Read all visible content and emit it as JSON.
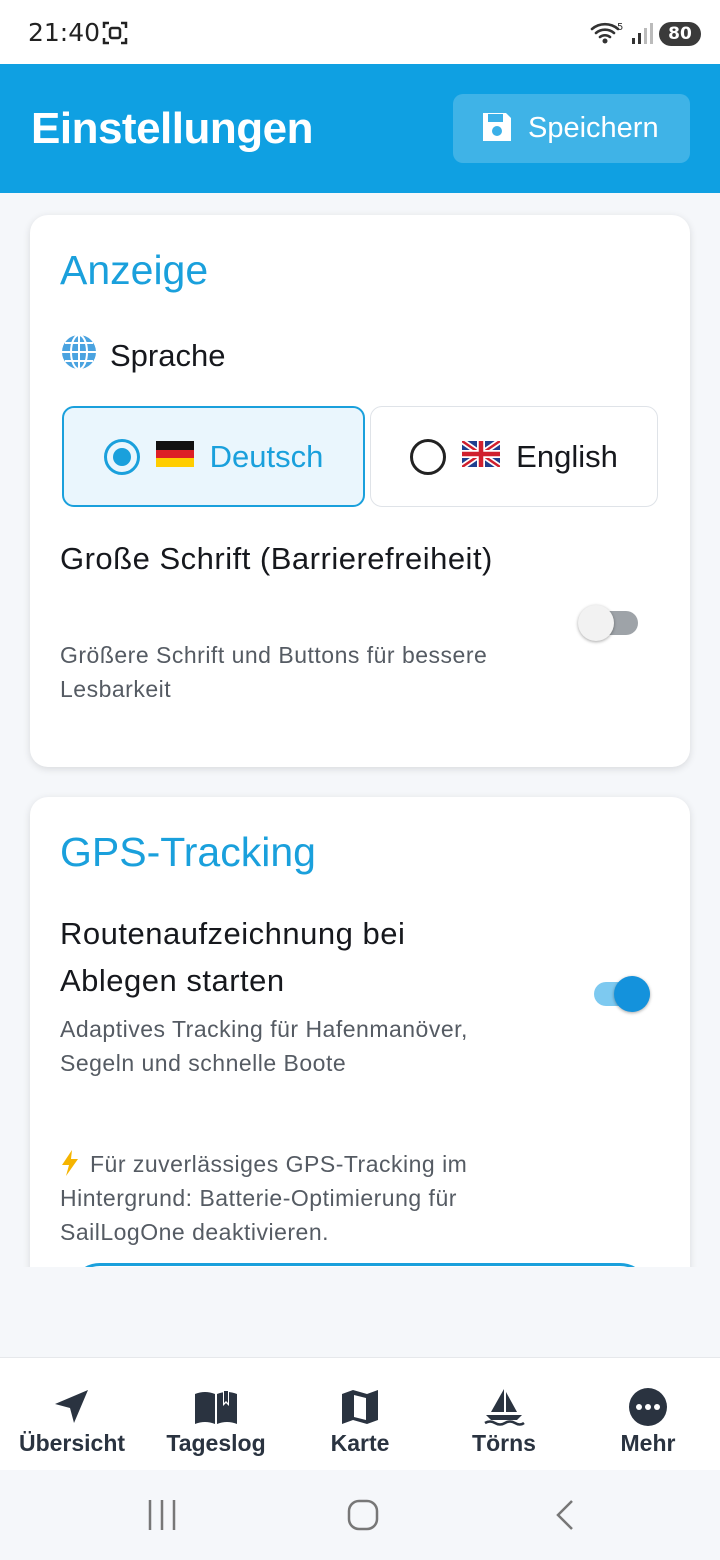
{
  "status_bar": {
    "time": "21:40",
    "battery": "80"
  },
  "header": {
    "title": "Einstellungen",
    "save_label": "Speichern"
  },
  "display_card": {
    "title": "Anzeige",
    "language_label": "Sprache",
    "languages": [
      {
        "label": "Deutsch",
        "selected": true
      },
      {
        "label": "English",
        "selected": false
      }
    ],
    "large_font": {
      "title": "Große Schrift (Barrierefreiheit)",
      "description": "Größere Schrift und Buttons für bessere Lesbarkeit",
      "enabled": false
    }
  },
  "gps_card": {
    "title": "GPS-Tracking",
    "route_recording": {
      "title": "Routenaufzeichnung bei Ablegen starten",
      "description": "Adaptives Tracking für Hafenmanöver, Segeln und schnelle Boote",
      "enabled": true
    },
    "hint": "Für zuverlässiges GPS-Tracking im Hintergrund: Batterie-Optimierung für SailLogOne deaktivieren."
  },
  "bottom_nav": [
    {
      "label": "Übersicht",
      "icon": "navigation-arrow-icon"
    },
    {
      "label": "Tageslog",
      "icon": "open-book-icon"
    },
    {
      "label": "Karte",
      "icon": "map-icon"
    },
    {
      "label": "Törns",
      "icon": "sailboat-icon"
    },
    {
      "label": "Mehr",
      "icon": "more-dots-icon"
    }
  ],
  "colors": {
    "accent": "#1aa0dc",
    "header": "#0fa0e2",
    "toggle_on": "#1492dc"
  }
}
